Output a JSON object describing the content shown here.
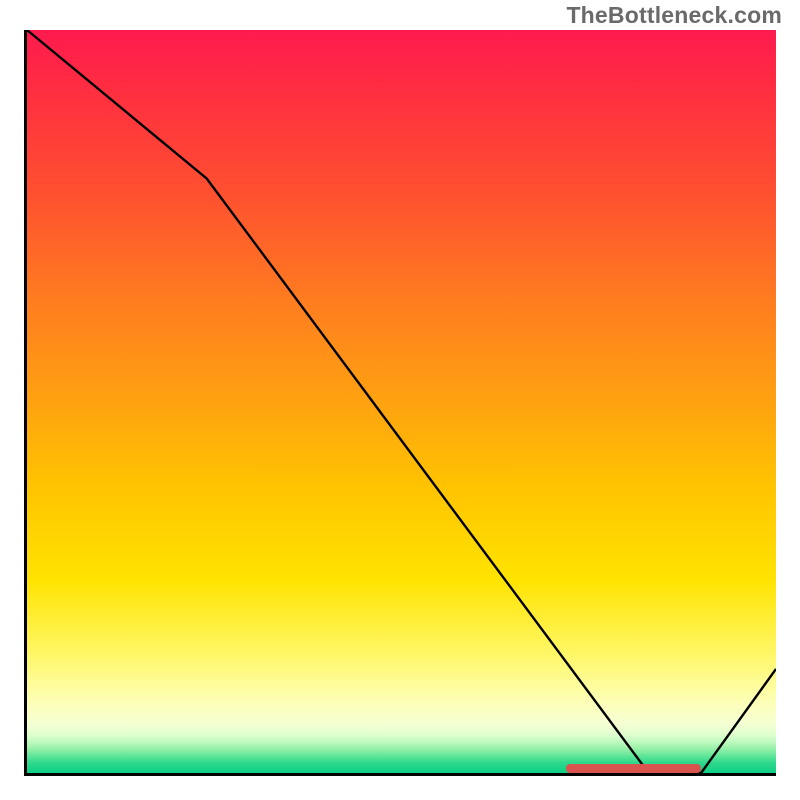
{
  "watermark": "TheBottleneck.com",
  "chart_data": {
    "type": "line",
    "title": "",
    "xlabel": "",
    "ylabel": "",
    "xlim": [
      0,
      100
    ],
    "ylim": [
      0,
      100
    ],
    "x": [
      0,
      24,
      83,
      90,
      100
    ],
    "values": [
      100,
      80,
      0,
      0,
      14
    ],
    "optimal_range": {
      "start": 72,
      "end": 90
    },
    "annotations": []
  },
  "colors": {
    "curve": "#000000",
    "optimal_marker": "#d9534f",
    "gradient_top": "#ff1a4f",
    "gradient_bottom": "#0ccf84"
  }
}
